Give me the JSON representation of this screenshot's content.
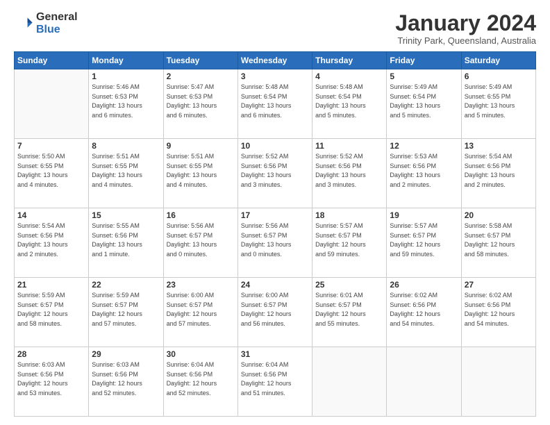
{
  "logo": {
    "line1": "General",
    "line2": "Blue"
  },
  "title": "January 2024",
  "subtitle": "Trinity Park, Queensland, Australia",
  "weekdays": [
    "Sunday",
    "Monday",
    "Tuesday",
    "Wednesday",
    "Thursday",
    "Friday",
    "Saturday"
  ],
  "weeks": [
    [
      {
        "day": "",
        "info": ""
      },
      {
        "day": "1",
        "info": "Sunrise: 5:46 AM\nSunset: 6:53 PM\nDaylight: 13 hours\nand 6 minutes."
      },
      {
        "day": "2",
        "info": "Sunrise: 5:47 AM\nSunset: 6:53 PM\nDaylight: 13 hours\nand 6 minutes."
      },
      {
        "day": "3",
        "info": "Sunrise: 5:48 AM\nSunset: 6:54 PM\nDaylight: 13 hours\nand 6 minutes."
      },
      {
        "day": "4",
        "info": "Sunrise: 5:48 AM\nSunset: 6:54 PM\nDaylight: 13 hours\nand 5 minutes."
      },
      {
        "day": "5",
        "info": "Sunrise: 5:49 AM\nSunset: 6:54 PM\nDaylight: 13 hours\nand 5 minutes."
      },
      {
        "day": "6",
        "info": "Sunrise: 5:49 AM\nSunset: 6:55 PM\nDaylight: 13 hours\nand 5 minutes."
      }
    ],
    [
      {
        "day": "7",
        "info": "Sunrise: 5:50 AM\nSunset: 6:55 PM\nDaylight: 13 hours\nand 4 minutes."
      },
      {
        "day": "8",
        "info": "Sunrise: 5:51 AM\nSunset: 6:55 PM\nDaylight: 13 hours\nand 4 minutes."
      },
      {
        "day": "9",
        "info": "Sunrise: 5:51 AM\nSunset: 6:55 PM\nDaylight: 13 hours\nand 4 minutes."
      },
      {
        "day": "10",
        "info": "Sunrise: 5:52 AM\nSunset: 6:56 PM\nDaylight: 13 hours\nand 3 minutes."
      },
      {
        "day": "11",
        "info": "Sunrise: 5:52 AM\nSunset: 6:56 PM\nDaylight: 13 hours\nand 3 minutes."
      },
      {
        "day": "12",
        "info": "Sunrise: 5:53 AM\nSunset: 6:56 PM\nDaylight: 13 hours\nand 2 minutes."
      },
      {
        "day": "13",
        "info": "Sunrise: 5:54 AM\nSunset: 6:56 PM\nDaylight: 13 hours\nand 2 minutes."
      }
    ],
    [
      {
        "day": "14",
        "info": "Sunrise: 5:54 AM\nSunset: 6:56 PM\nDaylight: 13 hours\nand 2 minutes."
      },
      {
        "day": "15",
        "info": "Sunrise: 5:55 AM\nSunset: 6:56 PM\nDaylight: 13 hours\nand 1 minute."
      },
      {
        "day": "16",
        "info": "Sunrise: 5:56 AM\nSunset: 6:57 PM\nDaylight: 13 hours\nand 0 minutes."
      },
      {
        "day": "17",
        "info": "Sunrise: 5:56 AM\nSunset: 6:57 PM\nDaylight: 13 hours\nand 0 minutes."
      },
      {
        "day": "18",
        "info": "Sunrise: 5:57 AM\nSunset: 6:57 PM\nDaylight: 12 hours\nand 59 minutes."
      },
      {
        "day": "19",
        "info": "Sunrise: 5:57 AM\nSunset: 6:57 PM\nDaylight: 12 hours\nand 59 minutes."
      },
      {
        "day": "20",
        "info": "Sunrise: 5:58 AM\nSunset: 6:57 PM\nDaylight: 12 hours\nand 58 minutes."
      }
    ],
    [
      {
        "day": "21",
        "info": "Sunrise: 5:59 AM\nSunset: 6:57 PM\nDaylight: 12 hours\nand 58 minutes."
      },
      {
        "day": "22",
        "info": "Sunrise: 5:59 AM\nSunset: 6:57 PM\nDaylight: 12 hours\nand 57 minutes."
      },
      {
        "day": "23",
        "info": "Sunrise: 6:00 AM\nSunset: 6:57 PM\nDaylight: 12 hours\nand 57 minutes."
      },
      {
        "day": "24",
        "info": "Sunrise: 6:00 AM\nSunset: 6:57 PM\nDaylight: 12 hours\nand 56 minutes."
      },
      {
        "day": "25",
        "info": "Sunrise: 6:01 AM\nSunset: 6:57 PM\nDaylight: 12 hours\nand 55 minutes."
      },
      {
        "day": "26",
        "info": "Sunrise: 6:02 AM\nSunset: 6:56 PM\nDaylight: 12 hours\nand 54 minutes."
      },
      {
        "day": "27",
        "info": "Sunrise: 6:02 AM\nSunset: 6:56 PM\nDaylight: 12 hours\nand 54 minutes."
      }
    ],
    [
      {
        "day": "28",
        "info": "Sunrise: 6:03 AM\nSunset: 6:56 PM\nDaylight: 12 hours\nand 53 minutes."
      },
      {
        "day": "29",
        "info": "Sunrise: 6:03 AM\nSunset: 6:56 PM\nDaylight: 12 hours\nand 52 minutes."
      },
      {
        "day": "30",
        "info": "Sunrise: 6:04 AM\nSunset: 6:56 PM\nDaylight: 12 hours\nand 52 minutes."
      },
      {
        "day": "31",
        "info": "Sunrise: 6:04 AM\nSunset: 6:56 PM\nDaylight: 12 hours\nand 51 minutes."
      },
      {
        "day": "",
        "info": ""
      },
      {
        "day": "",
        "info": ""
      },
      {
        "day": "",
        "info": ""
      }
    ]
  ]
}
